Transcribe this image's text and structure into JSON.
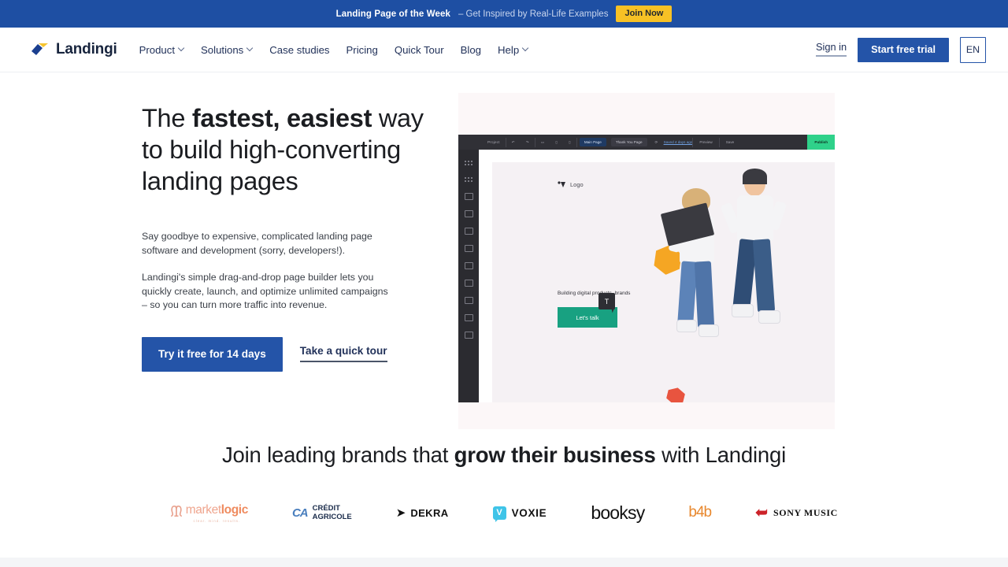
{
  "promo": {
    "strong": "Landing Page of the Week",
    "rest": "– Get Inspired by Real-Life Examples",
    "button": "Join Now",
    "bg": "#1e4fa3",
    "button_bg": "#f7c125"
  },
  "header": {
    "brand": "Landingi",
    "nav": [
      {
        "label": "Product",
        "caret": true
      },
      {
        "label": "Solutions",
        "caret": true
      },
      {
        "label": "Case studies",
        "caret": false
      },
      {
        "label": "Pricing",
        "caret": false
      },
      {
        "label": "Quick Tour",
        "caret": false
      },
      {
        "label": "Blog",
        "caret": false
      },
      {
        "label": "Help",
        "caret": true
      }
    ],
    "sign_in": "Sign in",
    "trial": "Start free trial",
    "lang": "EN",
    "accent": "#2454a8"
  },
  "hero": {
    "title_plain_1": "The ",
    "title_bold": "fastest, easiest",
    "title_plain_2": " way to build high-converting landing pages",
    "paragraph_1": "Say goodbye to expensive, complicated landing page software and development (sorry, developers!).",
    "paragraph_2": "Landingi's simple drag-and-drop page builder lets you quickly create, launch, and optimize unlimited campaigns – so you can turn more traffic into revenue.",
    "cta_primary": "Try it free for 14 days",
    "cta_secondary": "Take a quick tour"
  },
  "mock_app": {
    "project_label": "Project",
    "tab_main": "Main Page",
    "tab_thanks": "Thank You Page",
    "saved": "Saved 4 days ago",
    "preview": "Preview",
    "save": "Save",
    "publish": "Publish",
    "page_logo": "Logo",
    "page_headline": "Building digital products, brands",
    "page_button": "Let's talk",
    "text_tool_badge": "T",
    "publish_color": "#2fd18a",
    "button_color": "#18a181"
  },
  "brands": {
    "title_plain_1": "Join leading brands that ",
    "title_bold_1": "grow their business",
    "title_plain_2": " with Landingi",
    "logos": [
      {
        "name": "marketlogic",
        "text_a": "market",
        "text_b": "logic",
        "sub": "clear. mind. results.",
        "color": "#ef8b5f"
      },
      {
        "name": "credit-agricole",
        "mark": "CA",
        "line1": "CRÉDIT",
        "line2": "AGRICOLE",
        "color": "#4a7fbe"
      },
      {
        "name": "dekra",
        "text": "DEKRA",
        "color": "#111111"
      },
      {
        "name": "voxie",
        "mark": "V",
        "text": "VOXIE",
        "color": "#3fc4e8"
      },
      {
        "name": "booksy",
        "text": "booksy",
        "color": "#111111"
      },
      {
        "name": "b4b",
        "text": "b4b",
        "color": "#e8882e"
      },
      {
        "name": "sony-music",
        "text": "SONY MUSIC",
        "color": "#cc2229"
      }
    ]
  }
}
